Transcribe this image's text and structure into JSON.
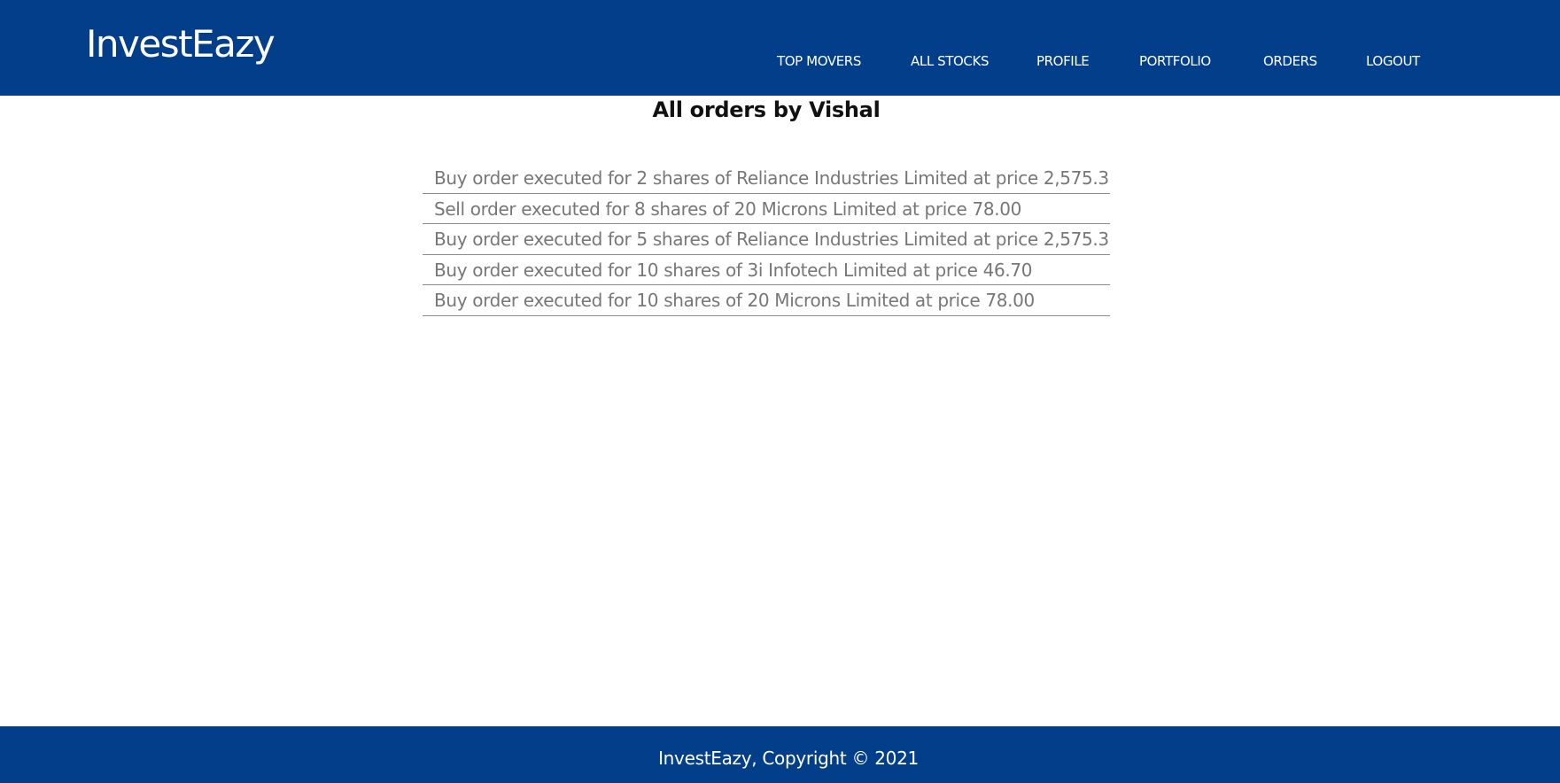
{
  "header": {
    "brand": "InvestEazy",
    "nav": [
      {
        "label": "TOP MOVERS"
      },
      {
        "label": "ALL STOCKS"
      },
      {
        "label": "PROFILE"
      },
      {
        "label": "PORTFOLIO"
      },
      {
        "label": "ORDERS"
      },
      {
        "label": "LOGOUT"
      }
    ],
    "background_color": "#023e8a"
  },
  "main": {
    "title": "All orders by Vishal",
    "orders": [
      {
        "text": "Buy order executed for 2 shares of Reliance Industries Limited at price 2,575.30"
      },
      {
        "text": "Sell order executed for 8 shares of 20 Microns Limited at price 78.00"
      },
      {
        "text": "Buy order executed for 5 shares of Reliance Industries Limited at price 2,575.30"
      },
      {
        "text": "Buy order executed for 10 shares of 3i Infotech Limited at price 46.70"
      },
      {
        "text": "Buy order executed for 10 shares of 20 Microns Limited at price 78.00"
      }
    ]
  },
  "footer": {
    "text": "InvestEazy, Copyright © 2021"
  }
}
